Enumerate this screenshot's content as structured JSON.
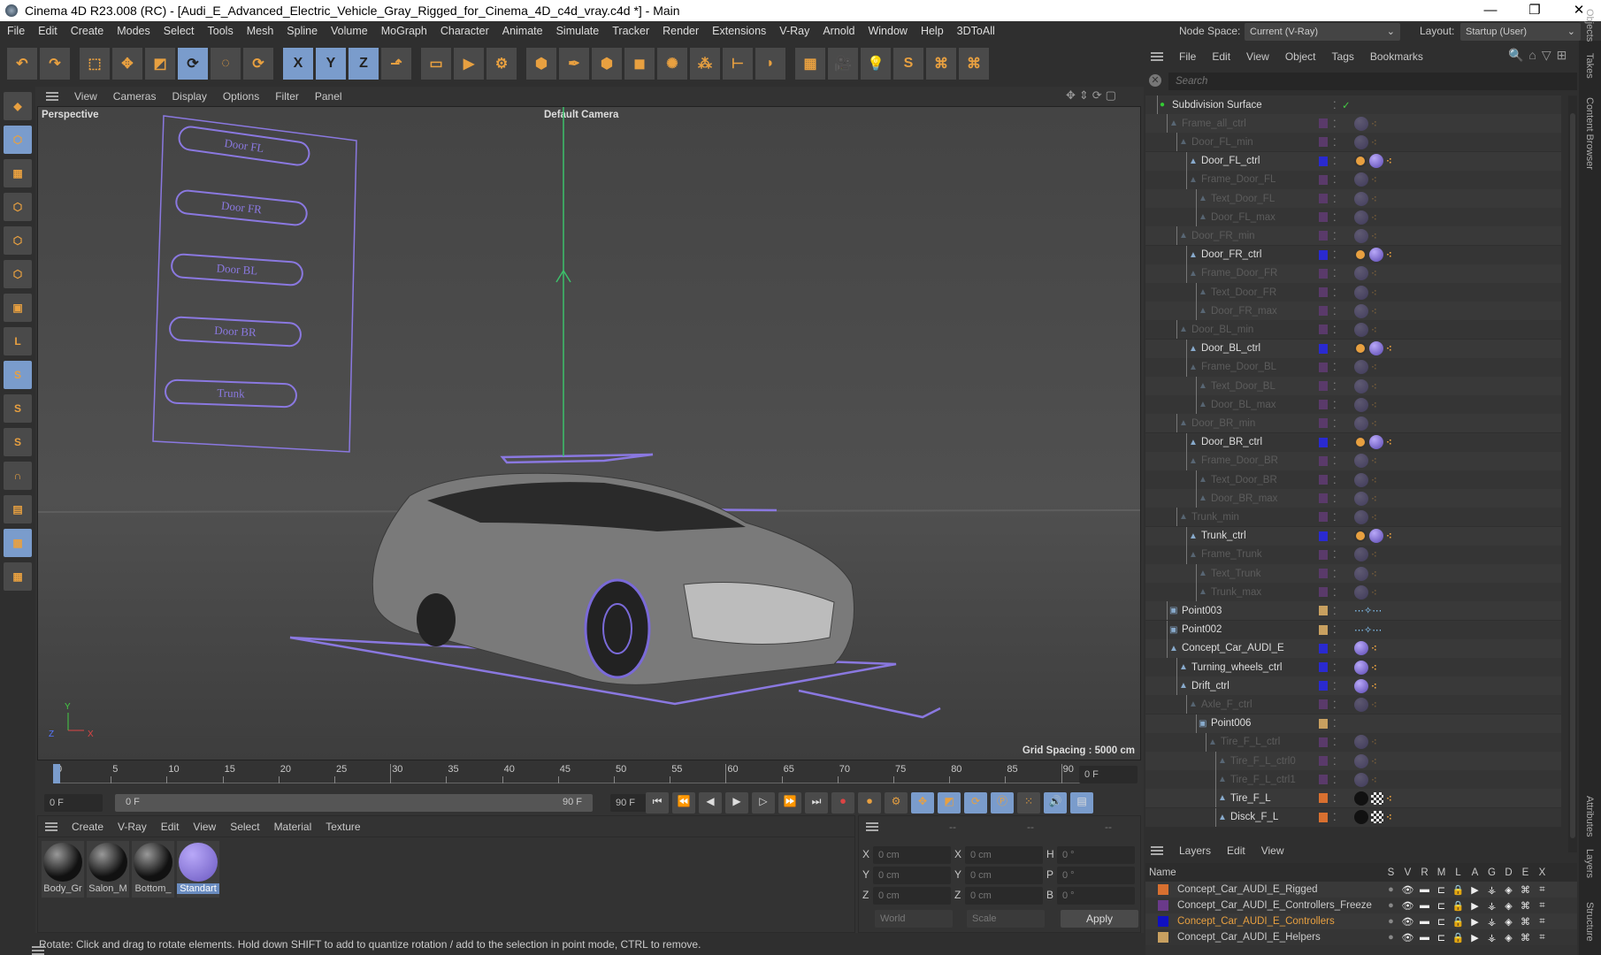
{
  "window": {
    "title": "Cinema 4D R23.008 (RC) - [Audi_E_Advanced_Electric_Vehicle_Gray_Rigged_for_Cinema_4D_c4d_vray.c4d *] - Main",
    "minimize": "—",
    "maximize": "❐",
    "close": "✕"
  },
  "menu": [
    "File",
    "Edit",
    "Create",
    "Modes",
    "Select",
    "Tools",
    "Mesh",
    "Spline",
    "Volume",
    "MoGraph",
    "Character",
    "Animate",
    "Simulate",
    "Tracker",
    "Render",
    "Extensions",
    "V-Ray",
    "Arnold",
    "Window",
    "Help",
    "3DToAll"
  ],
  "toolbar": [
    {
      "icon": "undo-icon",
      "g": "↶"
    },
    {
      "icon": "redo-icon",
      "g": "↷"
    },
    {
      "icon": "live-selection-icon",
      "g": "⬚",
      "gap": true
    },
    {
      "icon": "move-icon",
      "g": "✥"
    },
    {
      "icon": "scale-icon",
      "g": "◩"
    },
    {
      "icon": "rotate-icon",
      "g": "⟳",
      "sel": true
    },
    {
      "icon": "psr-icon",
      "g": "◌"
    },
    {
      "icon": "recent-tool-icon",
      "g": "⟳"
    },
    {
      "icon": "x-axis-icon",
      "g": "X",
      "sel": true,
      "gap": true
    },
    {
      "icon": "y-axis-icon",
      "g": "Y",
      "sel": true
    },
    {
      "icon": "z-axis-icon",
      "g": "Z",
      "sel": true
    },
    {
      "icon": "coordinate-system-icon",
      "g": "⬏"
    },
    {
      "icon": "render-view-icon",
      "g": "▭",
      "gap": true
    },
    {
      "icon": "render-picture-viewer-icon",
      "g": "▶"
    },
    {
      "icon": "render-settings-icon",
      "g": "⚙"
    },
    {
      "icon": "cube-icon",
      "g": "⬢",
      "gap": true
    },
    {
      "icon": "pen-icon",
      "g": "✒"
    },
    {
      "icon": "subdivision-icon",
      "g": "⬢"
    },
    {
      "icon": "extrude-icon",
      "g": "◼"
    },
    {
      "icon": "mograph-cloner-icon",
      "g": "✺"
    },
    {
      "icon": "cloner-icon",
      "g": "⁂"
    },
    {
      "icon": "deformer-icon",
      "g": "⊢"
    },
    {
      "icon": "field-icon",
      "g": "◗"
    },
    {
      "icon": "floor-icon",
      "g": "▦",
      "gap": true
    },
    {
      "icon": "camera-icon",
      "g": "🎥"
    },
    {
      "icon": "light-icon",
      "g": "💡"
    },
    {
      "icon": "vray-icon",
      "g": "S"
    },
    {
      "icon": "python-icon",
      "g": "⌘"
    },
    {
      "icon": "python-icon-2",
      "g": "⌘"
    }
  ],
  "leftTools": [
    {
      "icon": "make-editable-icon",
      "g": "◆"
    },
    {
      "icon": "model-mode-icon",
      "g": "⬡",
      "sel": true
    },
    {
      "icon": "texture-mode-icon",
      "g": "▦"
    },
    {
      "icon": "points-mode-icon",
      "g": "⬡"
    },
    {
      "icon": "edges-mode-icon",
      "g": "⬡"
    },
    {
      "icon": "polygons-mode-icon",
      "g": "⬡"
    },
    {
      "icon": "uv-mode-icon",
      "g": "▣"
    },
    {
      "icon": "axis-mode-icon",
      "g": "L"
    },
    {
      "icon": "snap-s-icon",
      "g": "S",
      "sel": true
    },
    {
      "icon": "snap-s2-icon",
      "g": "S"
    },
    {
      "icon": "snap-s3-icon",
      "g": "S"
    },
    {
      "icon": "magnet-icon",
      "g": "∩"
    },
    {
      "icon": "workplane-icon",
      "g": "▤"
    },
    {
      "icon": "grid-icon",
      "g": "▦",
      "sel": true
    },
    {
      "icon": "grid-lock-icon",
      "g": "▦"
    }
  ],
  "viewport": {
    "menu": [
      "View",
      "Cameras",
      "Display",
      "Options",
      "Filter",
      "Panel"
    ],
    "name": "Perspective",
    "camera": "Default Camera",
    "grid_spacing": "Grid Spacing : 5000 cm",
    "controllers": [
      "Door FL",
      "Door FR",
      "Door BL",
      "Door BR",
      "Trunk"
    ],
    "axis_labels": {
      "y": "Y",
      "z": "Z",
      "x": "X"
    }
  },
  "timeline": {
    "ticks": [
      "0",
      "5",
      "10",
      "15",
      "20",
      "25",
      "30",
      "35",
      "40",
      "45",
      "50",
      "55",
      "60",
      "65",
      "70",
      "75",
      "80",
      "85",
      "90"
    ],
    "current": "0 F",
    "start": "0 F",
    "range_start": "0 F",
    "range_end": "90 F",
    "end": "90 F"
  },
  "materials": {
    "menu": [
      "Create",
      "V-Ray",
      "Edit",
      "View",
      "Select",
      "Material",
      "Texture"
    ],
    "items": [
      {
        "name": "Body_Gr",
        "kind": "dark"
      },
      {
        "name": "Salon_M",
        "kind": "dark"
      },
      {
        "name": "Bottom_",
        "kind": "dark"
      },
      {
        "name": "Standart",
        "kind": "purple",
        "selected": true
      }
    ]
  },
  "coords": {
    "headers": [
      "--",
      "--",
      "--"
    ],
    "rows": [
      {
        "a": "X",
        "av": "0 cm",
        "b": "X",
        "bv": "0 cm",
        "c": "H",
        "cv": "0 °"
      },
      {
        "a": "Y",
        "av": "0 cm",
        "b": "Y",
        "bv": "0 cm",
        "c": "P",
        "cv": "0 °"
      },
      {
        "a": "Z",
        "av": "0 cm",
        "b": "Z",
        "bv": "0 cm",
        "c": "B",
        "cv": "0 °"
      }
    ],
    "world": "World",
    "scale": "Scale",
    "apply": "Apply"
  },
  "status": "Rotate: Click and drag to rotate elements. Hold down SHIFT to add to quantize rotation / add to the selection in point mode, CTRL to remove.",
  "nodespace": {
    "label": "Node Space:",
    "value": "Current (V-Ray)",
    "layout_label": "Layout:",
    "layout_value": "Startup (User)"
  },
  "objects": {
    "menu": [
      "File",
      "Edit",
      "View",
      "Object",
      "Tags",
      "Bookmarks"
    ],
    "search_placeholder": "Search",
    "tree": [
      {
        "n": "Subdivision Surface",
        "l": 0,
        "c": "",
        "t": "sub"
      },
      {
        "n": "Frame_all_ctrl",
        "l": 1,
        "d": 1,
        "c": "#5a3a6a"
      },
      {
        "n": "Door_FL_min",
        "l": 2,
        "d": 1,
        "c": "#5a3a6a"
      },
      {
        "n": "Door_FL_ctrl",
        "l": 3,
        "c": "#2a2ad0",
        "t": "ctrl"
      },
      {
        "n": "Frame_Door_FL",
        "l": 3,
        "d": 1,
        "c": "#5a3a6a"
      },
      {
        "n": "Text_Door_FL",
        "l": 4,
        "d": 1,
        "c": "#5a3a6a"
      },
      {
        "n": "Door_FL_max",
        "l": 4,
        "d": 1,
        "c": "#5a3a6a"
      },
      {
        "n": "Door_FR_min",
        "l": 2,
        "d": 1,
        "c": "#5a3a6a"
      },
      {
        "n": "Door_FR_ctrl",
        "l": 3,
        "c": "#2a2ad0",
        "t": "ctrl"
      },
      {
        "n": "Frame_Door_FR",
        "l": 3,
        "d": 1,
        "c": "#5a3a6a"
      },
      {
        "n": "Text_Door_FR",
        "l": 4,
        "d": 1,
        "c": "#5a3a6a"
      },
      {
        "n": "Door_FR_max",
        "l": 4,
        "d": 1,
        "c": "#5a3a6a"
      },
      {
        "n": "Door_BL_min",
        "l": 2,
        "d": 1,
        "c": "#5a3a6a"
      },
      {
        "n": "Door_BL_ctrl",
        "l": 3,
        "c": "#2a2ad0",
        "t": "ctrl"
      },
      {
        "n": "Frame_Door_BL",
        "l": 3,
        "d": 1,
        "c": "#5a3a6a"
      },
      {
        "n": "Text_Door_BL",
        "l": 4,
        "d": 1,
        "c": "#5a3a6a"
      },
      {
        "n": "Door_BL_max",
        "l": 4,
        "d": 1,
        "c": "#5a3a6a"
      },
      {
        "n": "Door_BR_min",
        "l": 2,
        "d": 1,
        "c": "#5a3a6a"
      },
      {
        "n": "Door_BR_ctrl",
        "l": 3,
        "c": "#2a2ad0",
        "t": "ctrl"
      },
      {
        "n": "Frame_Door_BR",
        "l": 3,
        "d": 1,
        "c": "#5a3a6a"
      },
      {
        "n": "Text_Door_BR",
        "l": 4,
        "d": 1,
        "c": "#5a3a6a"
      },
      {
        "n": "Door_BR_max",
        "l": 4,
        "d": 1,
        "c": "#5a3a6a"
      },
      {
        "n": "Trunk_min",
        "l": 2,
        "d": 1,
        "c": "#5a3a6a"
      },
      {
        "n": "Trunk_ctrl",
        "l": 3,
        "c": "#2a2ad0",
        "t": "ctrl"
      },
      {
        "n": "Frame_Trunk",
        "l": 3,
        "d": 1,
        "c": "#5a3a6a"
      },
      {
        "n": "Text_Trunk",
        "l": 4,
        "d": 1,
        "c": "#5a3a6a"
      },
      {
        "n": "Trunk_max",
        "l": 4,
        "d": 1,
        "c": "#5a3a6a"
      },
      {
        "n": "Point003",
        "l": 1,
        "c": "#c8a060",
        "t": "pt"
      },
      {
        "n": "Point002",
        "l": 1,
        "c": "#c8a060",
        "t": "pt"
      },
      {
        "n": "Concept_Car_AUDI_E",
        "l": 1,
        "c": "#2a2ad0",
        "t": "mat"
      },
      {
        "n": "Turning_wheels_ctrl",
        "l": 2,
        "c": "#2a2ad0",
        "t": "mat"
      },
      {
        "n": "Drift_ctrl",
        "l": 2,
        "c": "#2a2ad0",
        "t": "mat"
      },
      {
        "n": "Axle_F_ctrl",
        "l": 3,
        "d": 1,
        "c": "#5a3a6a"
      },
      {
        "n": "Point006",
        "l": 4,
        "c": "#c8a060"
      },
      {
        "n": "Tire_F_L_ctrl",
        "l": 5,
        "d": 1,
        "c": "#5a3a6a"
      },
      {
        "n": "Tire_F_L_ctrl0",
        "l": 6,
        "d": 1,
        "c": "#5a3a6a"
      },
      {
        "n": "Tire_F_L_ctrl1",
        "l": 6,
        "d": 1,
        "c": "#5a3a6a"
      },
      {
        "n": "Tire_F_L",
        "l": 6,
        "c": "#d87030",
        "t": "tire"
      },
      {
        "n": "Disck_F_L",
        "l": 6,
        "c": "#d87030",
        "t": "tire"
      }
    ]
  },
  "layers": {
    "menu": [
      "Layers",
      "Edit",
      "View"
    ],
    "name_header": "Name",
    "cols": [
      "S",
      "V",
      "R",
      "M",
      "L",
      "A",
      "G",
      "D",
      "E",
      "X"
    ],
    "items": [
      {
        "name": "Concept_Car_AUDI_E_Rigged",
        "color": "#d87030"
      },
      {
        "name": "Concept_Car_AUDI_E_Controllers_Freeze",
        "color": "#6a3a8a"
      },
      {
        "name": "Concept_Car_AUDI_E_Controllers",
        "color": "#1010c0",
        "active": true
      },
      {
        "name": "Concept_Car_AUDI_E_Helpers",
        "color": "#c8a060"
      }
    ]
  },
  "sidetabs": [
    "Objects",
    "Takes",
    "Content Browser",
    "Attributes",
    "Layers",
    "Structure"
  ]
}
